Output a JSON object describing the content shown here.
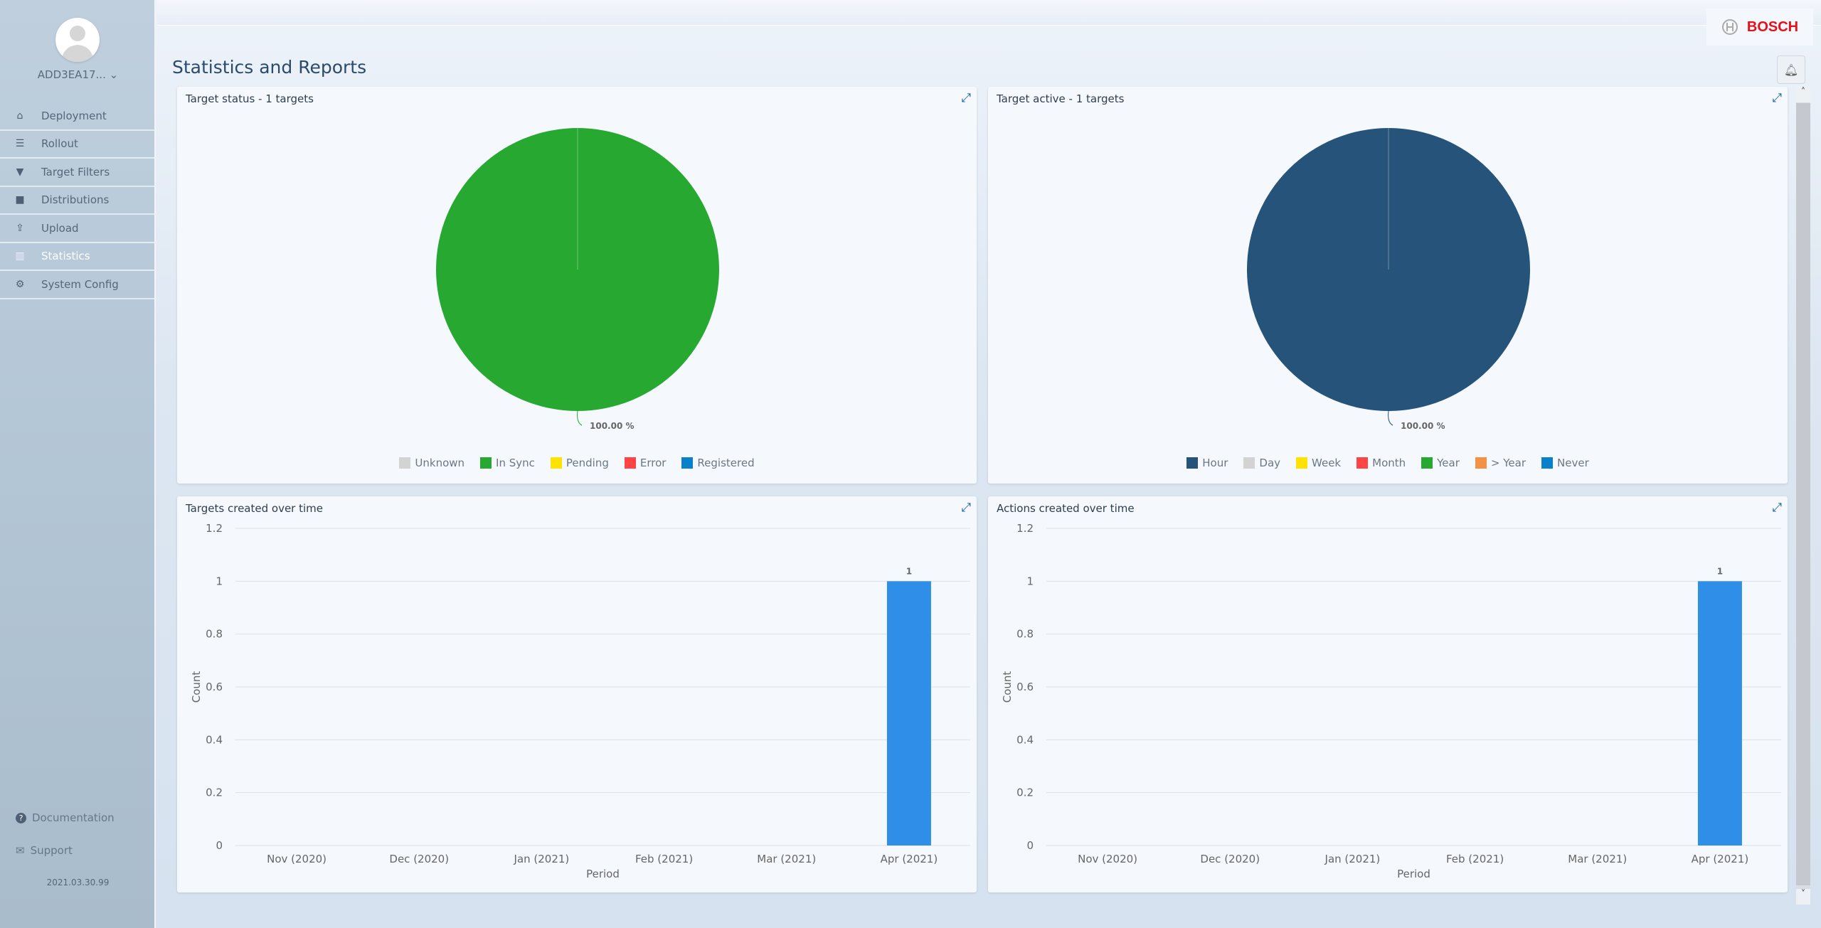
{
  "sidebar": {
    "user": "ADD3EA17...",
    "items": [
      {
        "label": "Deployment",
        "icon": "home-icon"
      },
      {
        "label": "Rollout",
        "icon": "list-icon"
      },
      {
        "label": "Target Filters",
        "icon": "filter-icon"
      },
      {
        "label": "Distributions",
        "icon": "briefcase-icon"
      },
      {
        "label": "Upload",
        "icon": "upload-icon"
      },
      {
        "label": "Statistics",
        "icon": "bar-chart-icon",
        "active": true
      },
      {
        "label": "System Config",
        "icon": "gear-icon"
      }
    ],
    "documentation": "Documentation",
    "support": "Support",
    "version": "2021.03.30.99"
  },
  "header": {
    "brand": "BOSCH",
    "page_title": "Statistics and Reports"
  },
  "colors": {
    "in_sync": "#27a830",
    "hour": "#265379",
    "bar": "#2f8fe8"
  },
  "chart_data": [
    {
      "type": "pie",
      "title": "Target status - 1 targets",
      "legend": [
        {
          "name": "Unknown",
          "color": "#d3d3d3"
        },
        {
          "name": "In Sync",
          "color": "#27a830"
        },
        {
          "name": "Pending",
          "color": "#ffe200"
        },
        {
          "name": "Error",
          "color": "#ff4444"
        },
        {
          "name": "Registered",
          "color": "#0880cc"
        }
      ],
      "slices": [
        {
          "name": "In Sync",
          "value": 100,
          "color": "#27a830"
        }
      ],
      "label": "100.00 %"
    },
    {
      "type": "pie",
      "title": "Target active - 1 targets",
      "legend": [
        {
          "name": "Hour",
          "color": "#265379"
        },
        {
          "name": "Day",
          "color": "#d3d3d3"
        },
        {
          "name": "Week",
          "color": "#ffe200"
        },
        {
          "name": "Month",
          "color": "#ff4444"
        },
        {
          "name": "Year",
          "color": "#27a830"
        },
        {
          "name": "> Year",
          "color": "#f39244"
        },
        {
          "name": "Never",
          "color": "#0880cc"
        }
      ],
      "slices": [
        {
          "name": "Hour",
          "value": 100,
          "color": "#265379"
        }
      ],
      "label": "100.00 %"
    },
    {
      "type": "bar",
      "title": "Targets created over time",
      "xlabel": "Period",
      "ylabel": "Count",
      "ylim": [
        0,
        1.2
      ],
      "yticks": [
        "0",
        "0.2",
        "0.4",
        "0.6",
        "0.8",
        "1",
        "1.2"
      ],
      "categories": [
        "Nov (2020)",
        "Dec (2020)",
        "Jan (2021)",
        "Feb (2021)",
        "Mar (2021)",
        "Apr (2021)"
      ],
      "values": [
        0,
        0,
        0,
        0,
        0,
        1
      ],
      "color": "#2f8fe8"
    },
    {
      "type": "bar",
      "title": "Actions created over time",
      "xlabel": "Period",
      "ylabel": "Count",
      "ylim": [
        0,
        1.2
      ],
      "yticks": [
        "0",
        "0.2",
        "0.4",
        "0.6",
        "0.8",
        "1",
        "1.2"
      ],
      "categories": [
        "Nov (2020)",
        "Dec (2020)",
        "Jan (2021)",
        "Feb (2021)",
        "Mar (2021)",
        "Apr (2021)"
      ],
      "values": [
        0,
        0,
        0,
        0,
        0,
        1
      ],
      "color": "#2f8fe8"
    }
  ]
}
